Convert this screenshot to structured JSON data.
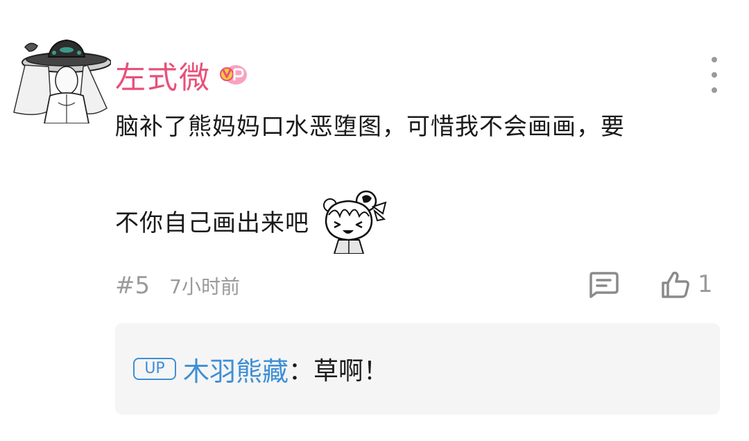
{
  "comment": {
    "username": "左式微",
    "body_line1": "脑补了熊妈妈口水恶堕图，可惜我不会画画，要",
    "body_line2": "不你自己画出来吧",
    "floor": "#5",
    "timestamp": "7小时前",
    "like_count": "1",
    "username_color": "#e8507a"
  },
  "reply": {
    "badge": "UP",
    "author": "木羽熊藏",
    "separator": "：",
    "text": "草啊！",
    "author_color": "#3d8fd6"
  },
  "icons": {
    "avatar": "avatar-wizard-hat",
    "vip": "vip-badge-icon",
    "more": "more-vertical-icon",
    "sticker": "laughing-girl-sticker",
    "reply": "comment-bubble-icon",
    "like": "thumbs-up-icon"
  }
}
